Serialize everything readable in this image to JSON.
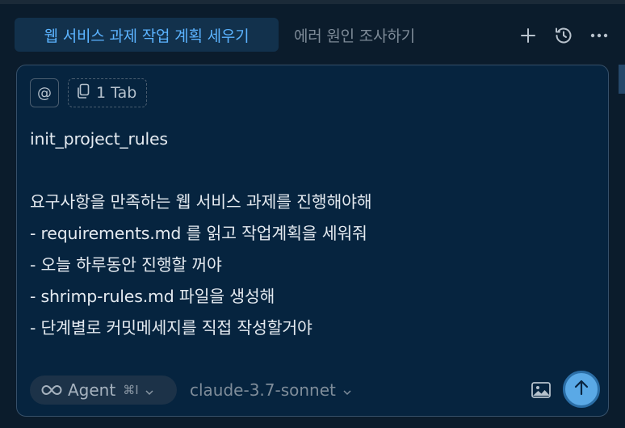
{
  "tabs": [
    {
      "label": "웹 서비스 과제 작업 계획 세우기",
      "active": true
    },
    {
      "label": "에러 원인 조사하기",
      "active": false
    }
  ],
  "toolbar_icons": [
    "plus-icon",
    "history-icon",
    "more-icon"
  ],
  "composer": {
    "mention_symbol": "@",
    "context_chip": "1 Tab",
    "prompt_lines": [
      "init_project_rules",
      "",
      "요구사항을 만족하는 웹 서비스 과제를 진행해야해",
      "- requirements.md 를 읽고 작업계획을 세워줘",
      "- 오늘 하루동안 진행할 꺼야",
      "- shrimp-rules.md 파일을 생성해",
      "- 단계별로 커밋메세지를 직접 작성할거야"
    ],
    "mode": {
      "label": "Agent",
      "shortcut": "⌘I"
    },
    "model": "claude-3.7-sonnet"
  },
  "colors": {
    "background": "#0b1c2c",
    "composer_bg": "#06243f",
    "active_tab_bg": "#12314c",
    "active_tab_text": "#5bb3ff",
    "send_button": "#5aa9e6"
  }
}
